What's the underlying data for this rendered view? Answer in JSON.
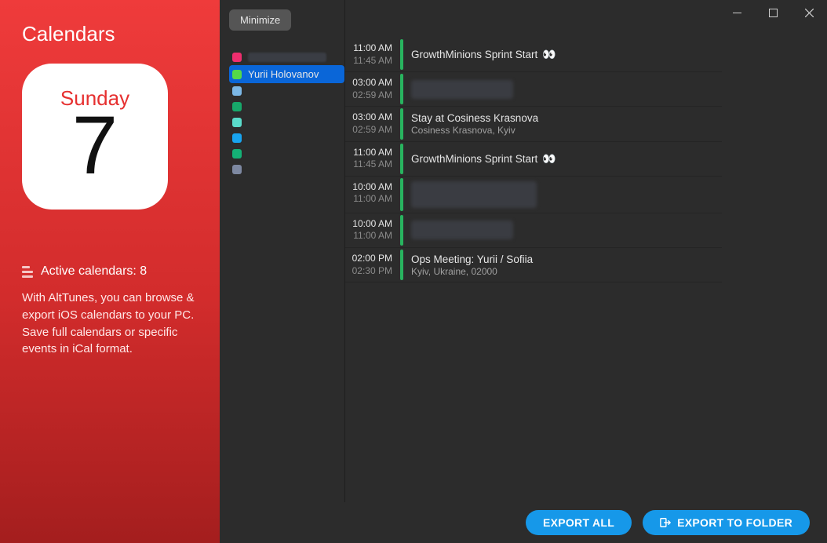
{
  "left": {
    "title": "Calendars",
    "day_name": "Sunday",
    "day_num": "7",
    "active_label": "Active calendars: 8",
    "description": "With AltTunes, you can browse & export iOS calendars to your PC. Save full calendars or specific events in iCal format."
  },
  "minimize_label": "Minimize",
  "calendars": [
    {
      "color": "#ef2e6e",
      "label": "",
      "redacted": true,
      "selected": false
    },
    {
      "color": "#55d948",
      "label": "Yurii Holovanov",
      "redacted": false,
      "selected": true
    },
    {
      "color": "#7bb7e6",
      "label": "",
      "redacted": false,
      "selected": false
    },
    {
      "color": "#17a86a",
      "label": "",
      "redacted": false,
      "selected": false
    },
    {
      "color": "#5adbca",
      "label": "",
      "redacted": false,
      "selected": false
    },
    {
      "color": "#18a4ef",
      "label": "",
      "redacted": false,
      "selected": false
    },
    {
      "color": "#14b176",
      "label": "",
      "redacted": false,
      "selected": false
    },
    {
      "color": "#7d88a1",
      "label": "",
      "redacted": false,
      "selected": false
    }
  ],
  "events": [
    {
      "t1": "11:00 AM",
      "t2": "11:45 AM",
      "title": "GrowthMinions Sprint Start",
      "subtitle": "",
      "eyes": true,
      "redacted": false
    },
    {
      "t1": "03:00 AM",
      "t2": "02:59 AM",
      "title": "",
      "subtitle": "",
      "eyes": false,
      "redacted": true
    },
    {
      "t1": "03:00 AM",
      "t2": "02:59 AM",
      "title": "Stay at Cosiness Krasnova",
      "subtitle": "Cosiness Krasnova, Kyiv",
      "eyes": false,
      "redacted": false
    },
    {
      "t1": "11:00 AM",
      "t2": "11:45 AM",
      "title": "GrowthMinions Sprint Start",
      "subtitle": "",
      "eyes": true,
      "redacted": false
    },
    {
      "t1": "10:00 AM",
      "t2": "11:00 AM",
      "title": "",
      "subtitle": "",
      "eyes": false,
      "redacted": true,
      "tall": true
    },
    {
      "t1": "10:00 AM",
      "t2": "11:00 AM",
      "title": "",
      "subtitle": "",
      "eyes": false,
      "redacted": true
    },
    {
      "t1": "02:00 PM",
      "t2": "02:30 PM",
      "title": "Ops Meeting: Yurii / Sofiia",
      "subtitle": "Kyiv, Ukraine, 02000",
      "eyes": false,
      "redacted": false
    }
  ],
  "buttons": {
    "export_all": "EXPORT ALL",
    "export_folder": "EXPORT TO FOLDER"
  }
}
